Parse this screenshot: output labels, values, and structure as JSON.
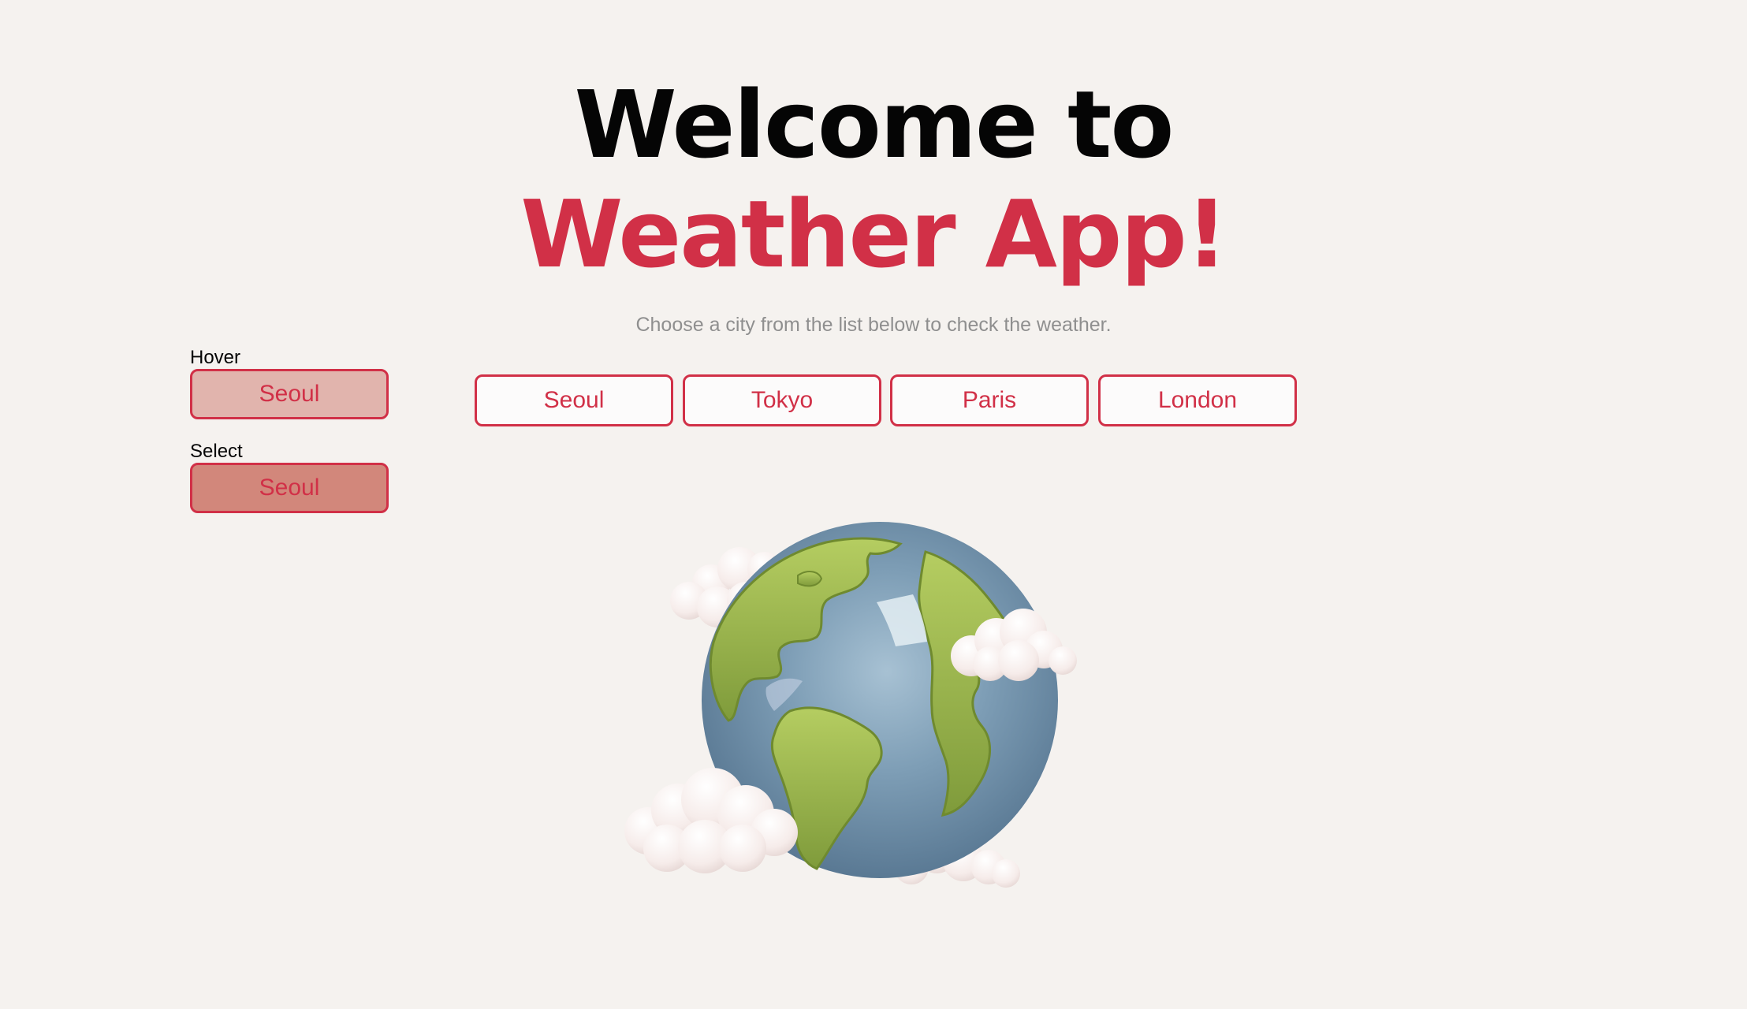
{
  "hero": {
    "line1": "Welcome to",
    "line2": "Weather App!",
    "subtitle": "Choose a city from the list below to check the weather."
  },
  "states": {
    "hover_label": "Hover",
    "hover_button": "Seoul",
    "select_label": "Select",
    "select_button": "Seoul"
  },
  "cities": [
    "Seoul",
    "Tokyo",
    "Paris",
    "London"
  ],
  "illustration": {
    "name": "globe-with-clouds-icon"
  },
  "colors": {
    "background": "#f5f2ef",
    "accent": "#d13047",
    "hover_fill": "#e1b4ad",
    "select_fill": "#d2877b",
    "subtitle": "#8f8f8f"
  }
}
